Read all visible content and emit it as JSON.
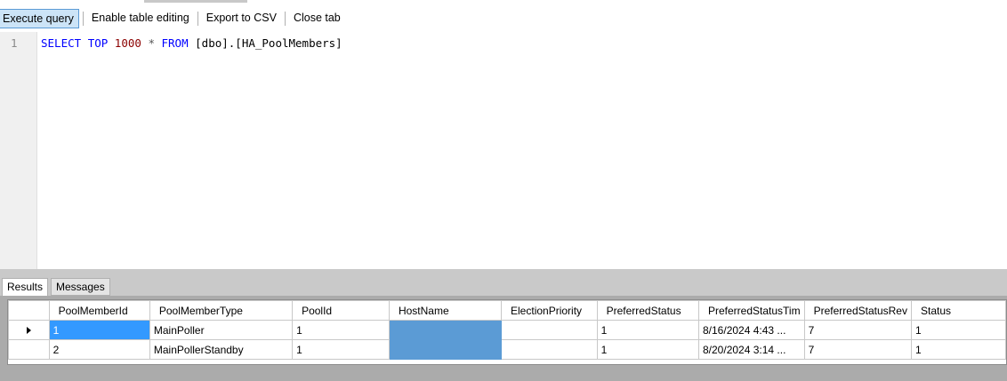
{
  "toolbar": {
    "execute_query": "Execute query",
    "enable_table_editing": "Enable table editing",
    "export_csv": "Export to CSV",
    "close_tab": "Close tab"
  },
  "editor": {
    "line_number": "1",
    "query": {
      "select": "SELECT",
      "top": "TOP",
      "limit": "1000",
      "star": "*",
      "from": "FROM",
      "table": "[dbo].[HA_PoolMembers]"
    }
  },
  "result_tabs": {
    "results": "Results",
    "messages": "Messages"
  },
  "grid": {
    "columns": [
      "PoolMemberId",
      "PoolMemberType",
      "PoolId",
      "HostName",
      "ElectionPriority",
      "PreferredStatus",
      "PreferredStatusTim",
      "PreferredStatusRev",
      "Status"
    ],
    "rows": [
      [
        "1",
        "MainPoller",
        "1",
        "",
        "",
        "1",
        "8/16/2024 4:43 ...",
        "7",
        "1"
      ],
      [
        "2",
        "MainPollerStandby",
        "1",
        "",
        "",
        "1",
        "8/20/2024 3:14 ...",
        "7",
        "1"
      ]
    ]
  },
  "colors": {
    "selection": "#3399ff",
    "redaction": "#5b9bd5",
    "keyword": "#0000ff",
    "number": "#8b0000"
  }
}
